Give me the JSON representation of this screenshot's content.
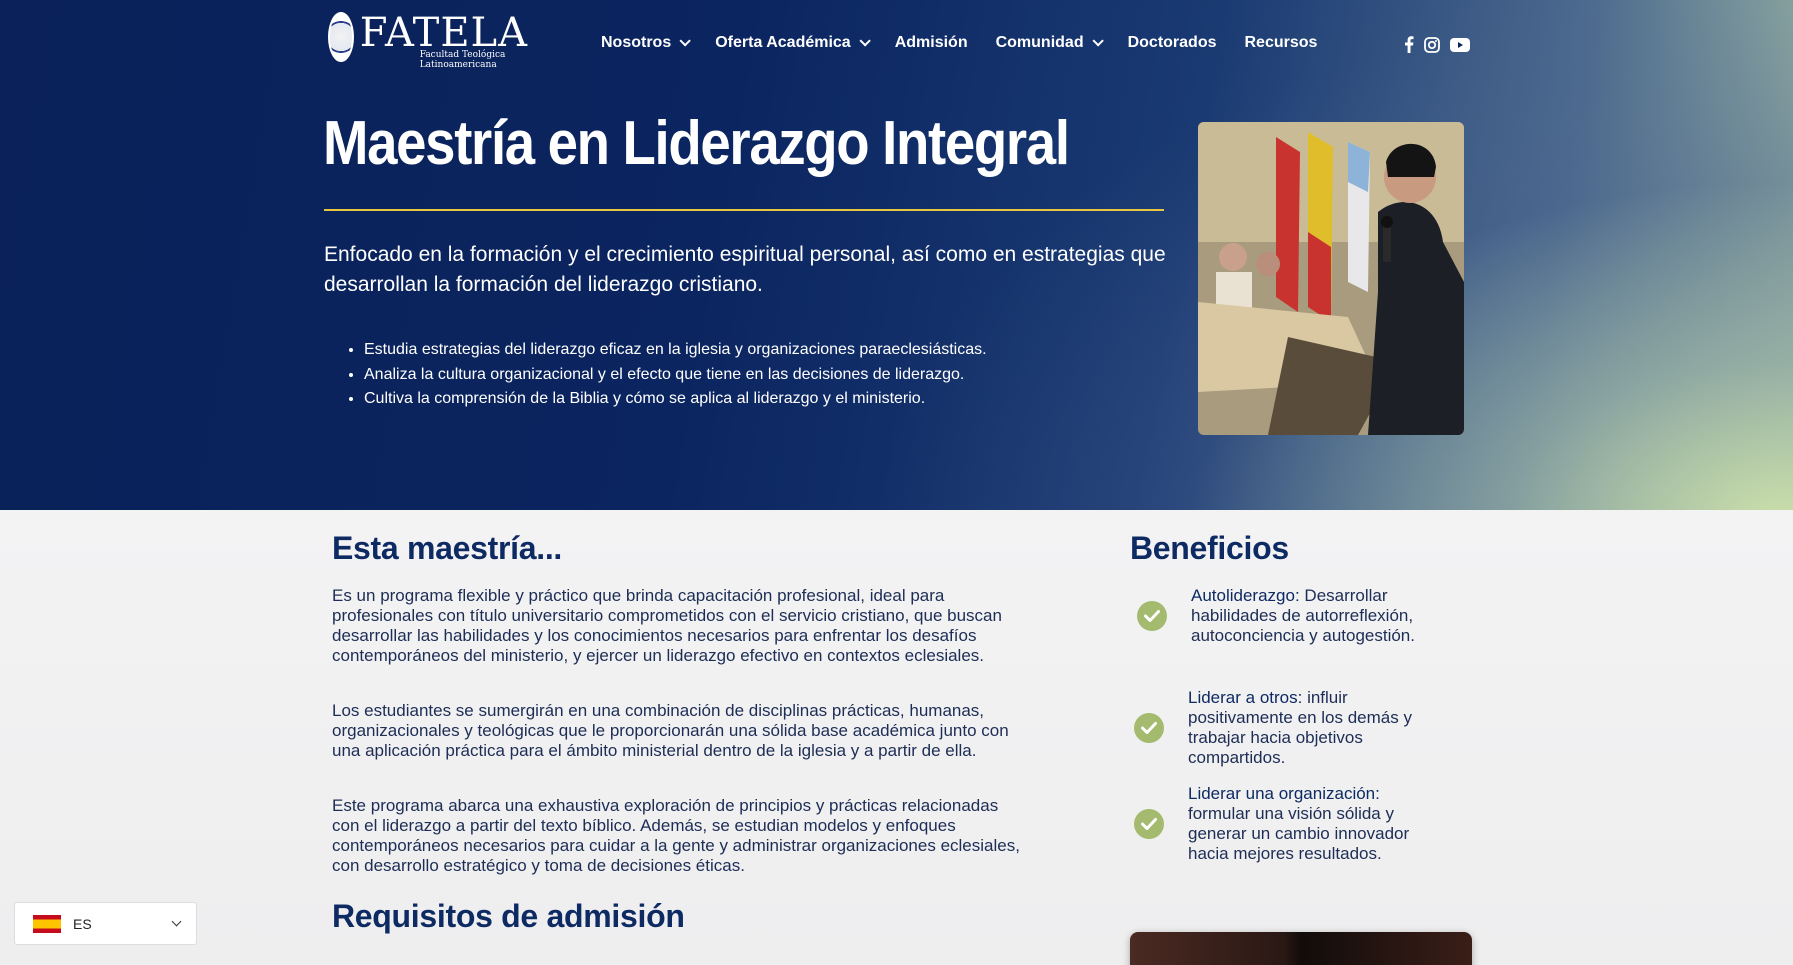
{
  "brand": {
    "name": "FATELA",
    "subtitle_line1": "Facultad Teológica",
    "subtitle_line2": "Latinoamericana"
  },
  "nav": {
    "items": [
      {
        "label": "Nosotros",
        "has_dropdown": true
      },
      {
        "label": "Oferta Académica",
        "has_dropdown": true
      },
      {
        "label": "Admisión",
        "has_dropdown": false
      },
      {
        "label": "Comunidad",
        "has_dropdown": true
      },
      {
        "label": "Doctorados",
        "has_dropdown": false
      },
      {
        "label": "Recursos",
        "has_dropdown": false
      }
    ],
    "social": [
      "facebook-icon",
      "instagram-icon",
      "youtube-icon"
    ]
  },
  "hero": {
    "title": "Maestría en Liderazgo Integral",
    "lead": "Enfocado en la formación y el crecimiento espiritual personal, así como en estrategias que desarrollan la formación del liderazgo cristiano.",
    "bullets": [
      "Estudia estrategias del liderazgo eficaz en la iglesia y organizaciones paraeclesiásticas.",
      "Analiza la cultura organizacional y el efecto que tiene en las decisiones de liderazgo.",
      "Cultiva la comprensión de la Biblia y cómo se aplica al liderazgo y el ministerio."
    ],
    "accent_color": "#e7c640"
  },
  "about": {
    "heading": "Esta maestría...",
    "paragraphs": [
      "Es un programa flexible y práctico que brinda capacitación profesional, ideal para profesionales con título universitario comprometidos con el servicio cristiano, que buscan desarrollar las habilidades y los conocimientos necesarios para enfrentar los desafíos contemporáneos del ministerio, y ejercer un liderazgo efectivo en contextos eclesiales.",
      "Los estudiantes se sumergirán en una combinación de disciplinas prácticas, humanas, organizacionales y teológicas que le proporcionarán una sólida base académica junto con una aplicación práctica para el ámbito ministerial dentro de la iglesia y a partir de ella.",
      "Este programa abarca una exhaustiva exploración de principios y prácticas relacionadas con el liderazgo a partir del texto bíblico. Además, se estudian modelos y enfoques contemporáneos necesarios para cuidar a la gente y administrar organizaciones eclesiales, con desarrollo estratégico y toma de decisiones éticas."
    ]
  },
  "benefits": {
    "heading": "Beneficios",
    "items": [
      {
        "title": "Autoliderazgo:",
        "text": " Desarrollar habilidades de autorreflexión, autoconciencia y autogestión."
      },
      {
        "title": "Liderar a otros:",
        "text": " influir positivamente en los demás y trabajar hacia objetivos compartidos."
      },
      {
        "title": "Liderar una organización:",
        "text": " formular una visión sólida y generar un cambio innovador hacia mejores resultados."
      }
    ],
    "check_color": "#a4ba6f"
  },
  "requirements": {
    "heading": "Requisitos de admisión"
  },
  "language": {
    "code": "ES"
  },
  "colors": {
    "navy": "#0e2a63",
    "hero_bg": "#0a2159"
  }
}
